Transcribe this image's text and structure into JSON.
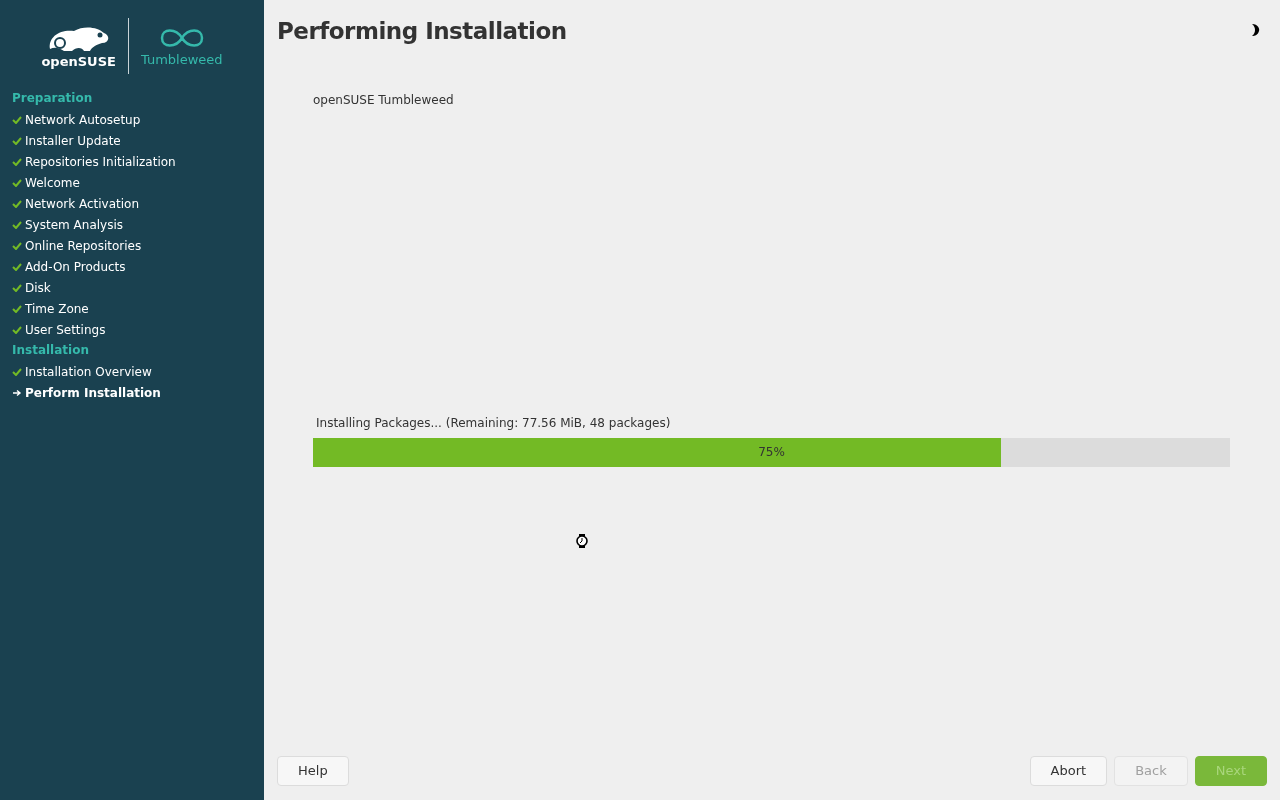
{
  "logo": {
    "brand": "openSUSE",
    "product": "Tumbleweed"
  },
  "sidebar": {
    "sections": [
      {
        "title": "Preparation",
        "items": [
          {
            "label": "Network Autosetup",
            "kind": "done"
          },
          {
            "label": "Installer Update",
            "kind": "done"
          },
          {
            "label": "Repositories Initialization",
            "kind": "done"
          },
          {
            "label": "Welcome",
            "kind": "done"
          },
          {
            "label": "Network Activation",
            "kind": "done"
          },
          {
            "label": "System Analysis",
            "kind": "done"
          },
          {
            "label": "Online Repositories",
            "kind": "done"
          },
          {
            "label": "Add-On Products",
            "kind": "done"
          },
          {
            "label": "Disk",
            "kind": "done"
          },
          {
            "label": "Time Zone",
            "kind": "done"
          },
          {
            "label": "User Settings",
            "kind": "done"
          }
        ]
      },
      {
        "title": "Installation",
        "items": [
          {
            "label": "Installation Overview",
            "kind": "done"
          },
          {
            "label": "Perform Installation",
            "kind": "current"
          }
        ]
      }
    ]
  },
  "page": {
    "title": "Performing Installation",
    "product": "openSUSE Tumbleweed",
    "progress": {
      "label": "Installing Packages... (Remaining: 77.56 MiB, 48 packages)",
      "level": 0.75,
      "reading": "75%"
    }
  },
  "buttons": {
    "left": [
      {
        "label": "Help",
        "primary": false,
        "disabled": false
      }
    ],
    "right": [
      {
        "label": "Abort",
        "primary": false,
        "disabled": false
      },
      {
        "label": "Back",
        "primary": false,
        "disabled": true
      },
      {
        "label": "Next",
        "primary": true,
        "disabled": true
      }
    ]
  }
}
